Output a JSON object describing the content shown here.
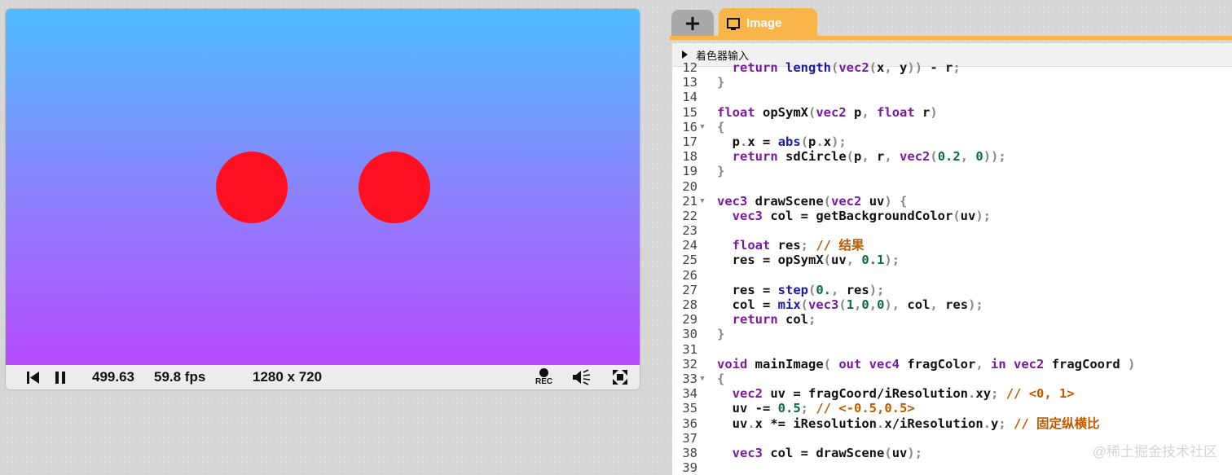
{
  "player": {
    "time": "499.63",
    "fps": "59.8 fps",
    "resolution": "1280 x 720",
    "rec_label": "REC",
    "colors": {
      "top": "#4dbcff",
      "bottom": "#b64bfd",
      "circle": "#ff0f1f"
    }
  },
  "editor": {
    "tabs": [
      {
        "label": "+",
        "icon": "plus-icon"
      },
      {
        "label": "Image",
        "icon": "monitor-icon"
      }
    ],
    "inputs_label": "着色器输入",
    "watermark": "@稀土掘金技术社区",
    "lines": [
      {
        "n": "12",
        "fold": false,
        "t": [
          [
            "  ",
            "tx"
          ],
          [
            "return ",
            "kw"
          ],
          [
            "length",
            "fn"
          ],
          [
            "(",
            "pn"
          ],
          [
            "vec2",
            "kw"
          ],
          [
            "(",
            "pn"
          ],
          [
            "x",
            ""
          ],
          [
            ", ",
            "pn"
          ],
          [
            "y",
            ""
          ],
          [
            "))",
            "pn"
          ],
          [
            " - ",
            "tx"
          ],
          [
            "r",
            "tx"
          ],
          [
            ";",
            "pn"
          ]
        ]
      },
      {
        "n": "13",
        "fold": false,
        "t": [
          [
            "}",
            "pn"
          ]
        ]
      },
      {
        "n": "14",
        "fold": false,
        "t": []
      },
      {
        "n": "15",
        "fold": false,
        "t": [
          [
            "float ",
            "kw"
          ],
          [
            "opSymX",
            "tx"
          ],
          [
            "(",
            "pn"
          ],
          [
            "vec2 ",
            "kw"
          ],
          [
            "p",
            "tx"
          ],
          [
            ", ",
            "pn"
          ],
          [
            "float ",
            "kw"
          ],
          [
            "r",
            "tx"
          ],
          [
            ")",
            "pn"
          ]
        ]
      },
      {
        "n": "16",
        "fold": true,
        "t": [
          [
            "{",
            "pn"
          ]
        ]
      },
      {
        "n": "17",
        "fold": false,
        "t": [
          [
            "  p",
            "tx"
          ],
          [
            ".",
            "dt"
          ],
          [
            "x ",
            "tx"
          ],
          [
            "= ",
            "tx"
          ],
          [
            "abs",
            "fn"
          ],
          [
            "(",
            "pn"
          ],
          [
            "p",
            "tx"
          ],
          [
            ".",
            "dt"
          ],
          [
            "x",
            "tx"
          ],
          [
            ");",
            "pn"
          ]
        ]
      },
      {
        "n": "18",
        "fold": false,
        "t": [
          [
            "  ",
            "tx"
          ],
          [
            "return ",
            "kw"
          ],
          [
            "sdCircle",
            "tx"
          ],
          [
            "(",
            "pn"
          ],
          [
            "p",
            "tx"
          ],
          [
            ", ",
            "pn"
          ],
          [
            "r",
            "tx"
          ],
          [
            ", ",
            "pn"
          ],
          [
            "vec2",
            "kw"
          ],
          [
            "(",
            "pn"
          ],
          [
            "0.2",
            "num"
          ],
          [
            ", ",
            "pn"
          ],
          [
            "0",
            "num"
          ],
          [
            "));",
            "pn"
          ]
        ]
      },
      {
        "n": "19",
        "fold": false,
        "t": [
          [
            "}",
            "pn"
          ]
        ]
      },
      {
        "n": "20",
        "fold": false,
        "t": []
      },
      {
        "n": "21",
        "fold": true,
        "t": [
          [
            "vec3 ",
            "kw"
          ],
          [
            "drawScene",
            "tx"
          ],
          [
            "(",
            "pn"
          ],
          [
            "vec2 ",
            "kw"
          ],
          [
            "uv",
            "tx"
          ],
          [
            ") {",
            "pn"
          ]
        ]
      },
      {
        "n": "22",
        "fold": false,
        "t": [
          [
            "  ",
            "tx"
          ],
          [
            "vec3 ",
            "kw"
          ],
          [
            "col ",
            "tx"
          ],
          [
            "= ",
            "tx"
          ],
          [
            "getBackgroundColor",
            "tx"
          ],
          [
            "(",
            "pn"
          ],
          [
            "uv",
            "tx"
          ],
          [
            ");",
            "pn"
          ]
        ]
      },
      {
        "n": "23",
        "fold": false,
        "t": []
      },
      {
        "n": "24",
        "fold": false,
        "t": [
          [
            "  ",
            "tx"
          ],
          [
            "float ",
            "kw"
          ],
          [
            "res",
            "tx"
          ],
          [
            "; ",
            "pn"
          ],
          [
            "// 结果",
            "cm"
          ]
        ]
      },
      {
        "n": "25",
        "fold": false,
        "t": [
          [
            "  res ",
            "tx"
          ],
          [
            "= ",
            "tx"
          ],
          [
            "opSymX",
            "tx"
          ],
          [
            "(",
            "pn"
          ],
          [
            "uv",
            "tx"
          ],
          [
            ", ",
            "pn"
          ],
          [
            "0.1",
            "num"
          ],
          [
            ");",
            "pn"
          ]
        ]
      },
      {
        "n": "26",
        "fold": false,
        "t": []
      },
      {
        "n": "27",
        "fold": false,
        "t": [
          [
            "  res ",
            "tx"
          ],
          [
            "= ",
            "tx"
          ],
          [
            "step",
            "fn"
          ],
          [
            "(",
            "pn"
          ],
          [
            "0.",
            "num"
          ],
          [
            ", ",
            "pn"
          ],
          [
            "res",
            "tx"
          ],
          [
            ");",
            "pn"
          ]
        ]
      },
      {
        "n": "28",
        "fold": false,
        "t": [
          [
            "  col ",
            "tx"
          ],
          [
            "= ",
            "tx"
          ],
          [
            "mix",
            "fn"
          ],
          [
            "(",
            "pn"
          ],
          [
            "vec3",
            "kw"
          ],
          [
            "(",
            "pn"
          ],
          [
            "1",
            "num"
          ],
          [
            ",",
            "pn"
          ],
          [
            "0",
            "num"
          ],
          [
            ",",
            "pn"
          ],
          [
            "0",
            "num"
          ],
          [
            "), ",
            "pn"
          ],
          [
            "col",
            "tx"
          ],
          [
            ", ",
            "pn"
          ],
          [
            "res",
            "tx"
          ],
          [
            ");",
            "pn"
          ]
        ]
      },
      {
        "n": "29",
        "fold": false,
        "t": [
          [
            "  ",
            "tx"
          ],
          [
            "return ",
            "kw"
          ],
          [
            "col",
            "tx"
          ],
          [
            ";",
            "pn"
          ]
        ]
      },
      {
        "n": "30",
        "fold": false,
        "t": [
          [
            "}",
            "pn"
          ]
        ]
      },
      {
        "n": "31",
        "fold": false,
        "t": []
      },
      {
        "n": "32",
        "fold": false,
        "t": [
          [
            "void ",
            "kw"
          ],
          [
            "mainImage",
            "tx"
          ],
          [
            "( ",
            "pn"
          ],
          [
            "out ",
            "kw"
          ],
          [
            "vec4 ",
            "kw"
          ],
          [
            "fragColor",
            "tx"
          ],
          [
            ", ",
            "pn"
          ],
          [
            "in ",
            "kw"
          ],
          [
            "vec2 ",
            "kw"
          ],
          [
            "fragCoord ",
            "tx"
          ],
          [
            ")",
            "pn"
          ]
        ]
      },
      {
        "n": "33",
        "fold": true,
        "t": [
          [
            "{",
            "pn"
          ]
        ]
      },
      {
        "n": "34",
        "fold": false,
        "t": [
          [
            "  ",
            "tx"
          ],
          [
            "vec2 ",
            "kw"
          ],
          [
            "uv ",
            "tx"
          ],
          [
            "= ",
            "tx"
          ],
          [
            "fragCoord",
            "tx"
          ],
          [
            "/",
            "tx"
          ],
          [
            "iResolution",
            "tx"
          ],
          [
            ".",
            "dt"
          ],
          [
            "xy",
            "tx"
          ],
          [
            "; ",
            "pn"
          ],
          [
            "// <0, 1>",
            "cm"
          ]
        ]
      },
      {
        "n": "35",
        "fold": false,
        "t": [
          [
            "  uv ",
            "tx"
          ],
          [
            "-= ",
            "tx"
          ],
          [
            "0.5",
            "num"
          ],
          [
            "; ",
            "pn"
          ],
          [
            "// <-0.5,0.5>",
            "cm"
          ]
        ]
      },
      {
        "n": "36",
        "fold": false,
        "t": [
          [
            "  uv",
            "tx"
          ],
          [
            ".",
            "dt"
          ],
          [
            "x ",
            "tx"
          ],
          [
            "*= ",
            "tx"
          ],
          [
            "iResolution",
            "tx"
          ],
          [
            ".",
            "dt"
          ],
          [
            "x",
            "tx"
          ],
          [
            "/",
            "tx"
          ],
          [
            "iResolution",
            "tx"
          ],
          [
            ".",
            "dt"
          ],
          [
            "y",
            "tx"
          ],
          [
            "; ",
            "pn"
          ],
          [
            "// 固定纵横比",
            "cm"
          ]
        ]
      },
      {
        "n": "37",
        "fold": false,
        "t": []
      },
      {
        "n": "38",
        "fold": false,
        "t": [
          [
            "  ",
            "tx"
          ],
          [
            "vec3 ",
            "kw"
          ],
          [
            "col ",
            "tx"
          ],
          [
            "= ",
            "tx"
          ],
          [
            "drawScene",
            "tx"
          ],
          [
            "(",
            "pn"
          ],
          [
            "uv",
            "tx"
          ],
          [
            ");",
            "pn"
          ]
        ]
      },
      {
        "n": "39",
        "fold": false,
        "t": []
      }
    ]
  }
}
